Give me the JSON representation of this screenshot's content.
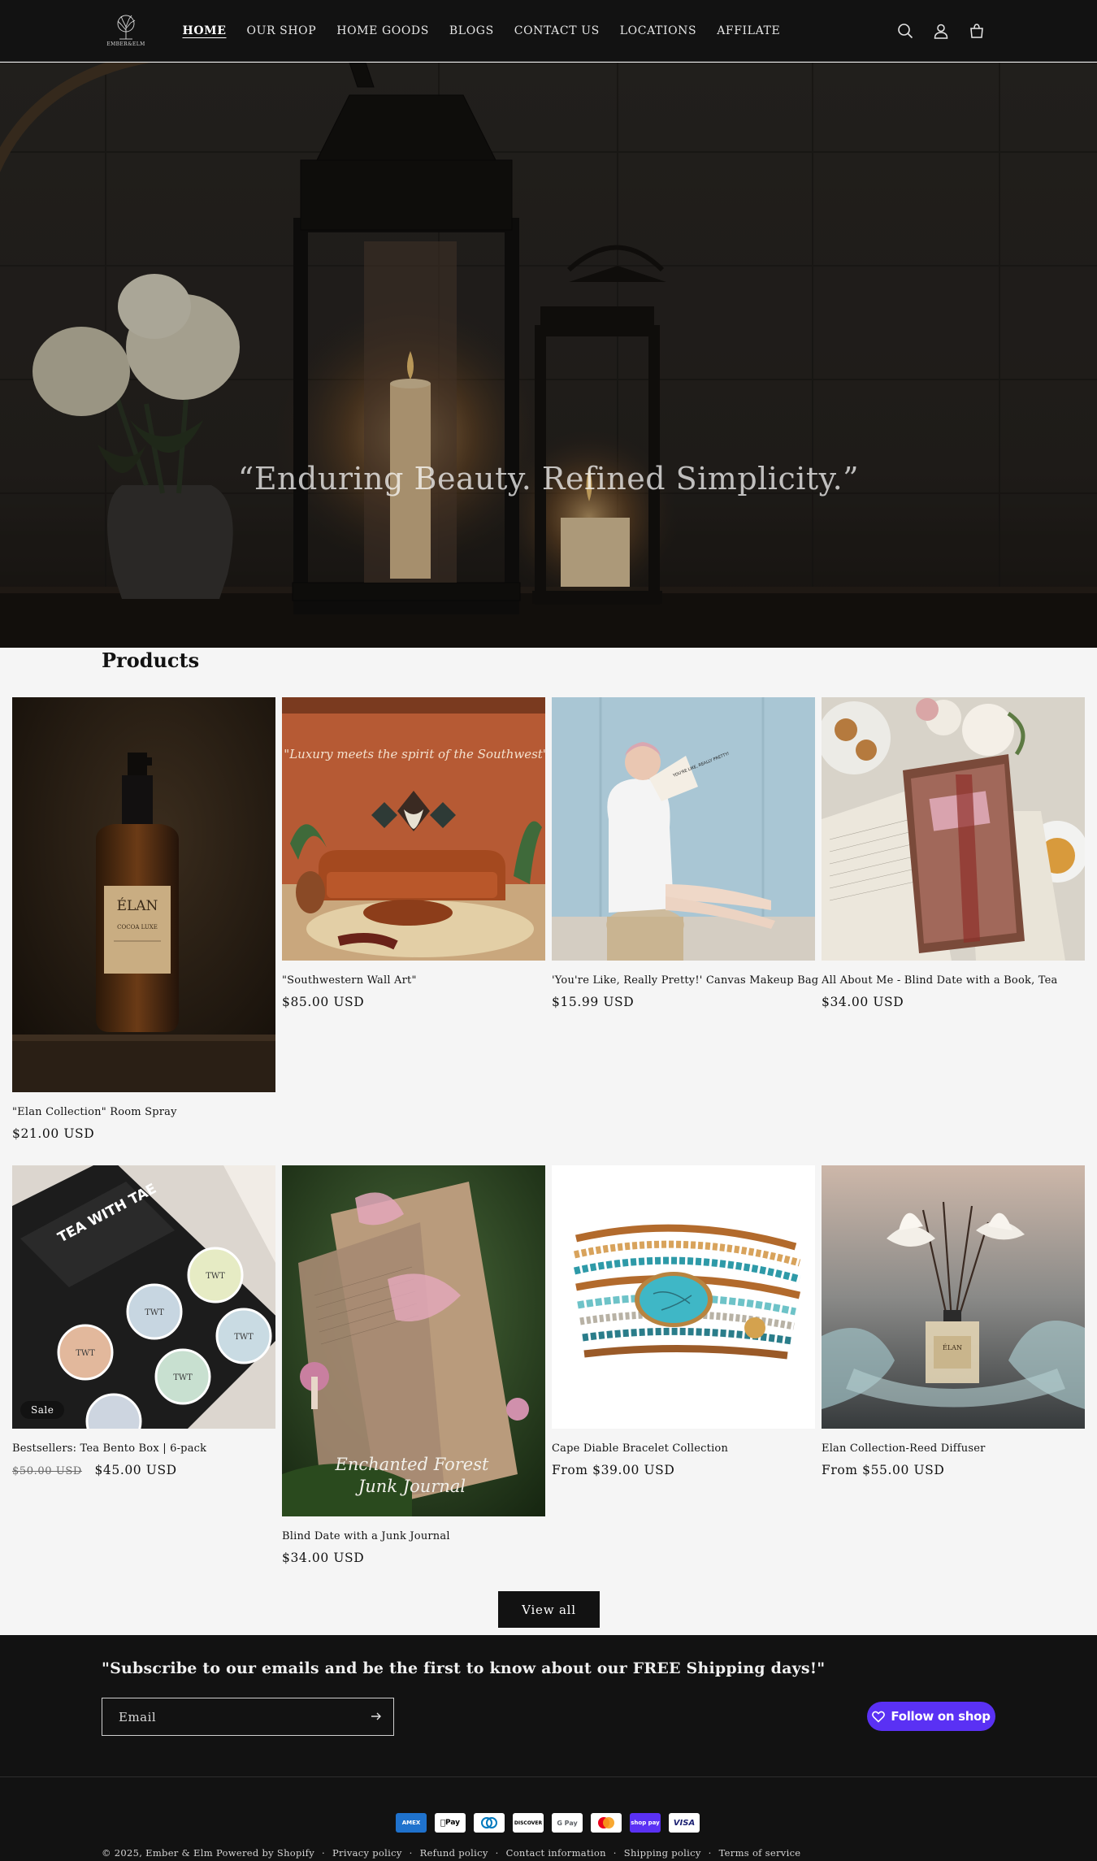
{
  "header": {
    "logo_text": "EMBER&ELM",
    "nav": [
      {
        "label": "HOME",
        "active": true
      },
      {
        "label": "OUR SHOP"
      },
      {
        "label": "HOME GOODS"
      },
      {
        "label": "BLOGS"
      },
      {
        "label": "CONTACT US"
      },
      {
        "label": "LOCATIONS"
      },
      {
        "label": "AFFILATE"
      }
    ],
    "icons": [
      "search-icon",
      "account-icon",
      "cart-icon"
    ]
  },
  "hero": {
    "quote": "“Enduring Beauty. Refined Simplicity.”"
  },
  "products": {
    "title": "Products",
    "items": [
      {
        "title": "\"Elan Collection\" Room Spray",
        "price": "$21.00 USD",
        "image": "amber-spray-bottle",
        "bottle_label": "ÉLAN",
        "bottle_sub": "COCOA LUXE"
      },
      {
        "title": "\"Southwestern Wall Art\"",
        "price": "$85.00 USD",
        "image": "southwestern-living-room",
        "image_text": "\"Luxury meets the spirit of the Southwest\""
      },
      {
        "title": "'You're Like, Really Pretty!' Canvas Makeup Bag",
        "price": "$15.99 USD",
        "image": "woman-with-makeup-bag",
        "bag_text": "YOU'RE LIKE, REALLY PRETTY!"
      },
      {
        "title": "All About Me - Blind Date with a Book, Tea",
        "price": "$34.00 USD",
        "image": "book-and-tea-flatlay"
      },
      {
        "title": "Bestsellers: Tea Bento Box | 6-pack",
        "old_price": "$50.00 USD",
        "price": "$45.00 USD",
        "badge": "Sale",
        "image": "tea-tins-box",
        "box_text": "TEA WITH TAE",
        "tin_text": "TWT"
      },
      {
        "title": "Blind Date with a Junk Journal",
        "price": "$34.00 USD",
        "image": "enchanted-forest-journal",
        "image_text_1": "Enchanted Forest",
        "image_text_2": "Junk Journal"
      },
      {
        "title": "Cape Diable Bracelet Collection",
        "price": "From $39.00 USD",
        "image": "turquoise-wrap-bracelet"
      },
      {
        "title": "Elan Collection-Reed Diffuser",
        "price": "From $55.00 USD",
        "image": "reed-diffuser",
        "bottle_label": "ÉLAN"
      }
    ],
    "view_all": "View all"
  },
  "footer": {
    "subscribe_heading": "\"Subscribe to our emails and be the first to know about our FREE Shipping days!\"",
    "email_placeholder": "Email",
    "follow_label": "Follow on shop",
    "payments": [
      "AMEX",
      "Pay",
      "Diners",
      "DISCOVER",
      "G Pay",
      "Mastercard",
      "shop pay",
      "VISA"
    ],
    "copyright": "© 2025, Ember & Elm",
    "powered": "Powered by Shopify",
    "links": [
      "Privacy policy",
      "Refund policy",
      "Contact information",
      "Shipping policy",
      "Terms of service"
    ]
  }
}
